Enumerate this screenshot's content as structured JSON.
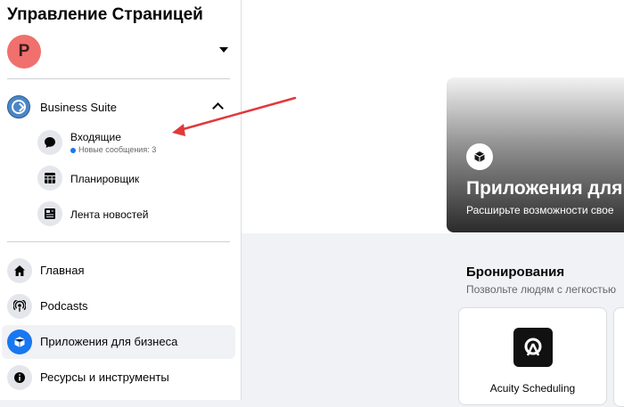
{
  "sidebar": {
    "title": "Управление Страницей",
    "avatar_letter": "P",
    "business_suite": {
      "label": "Business Suite",
      "items": [
        {
          "label": "Входящие",
          "sublabel": "Новые сообщения: 3",
          "icon": "chat-bubble-icon"
        },
        {
          "label": "Планировщик",
          "icon": "calendar-grid-icon"
        },
        {
          "label": "Лента новостей",
          "icon": "news-feed-icon"
        }
      ]
    },
    "nav": [
      {
        "label": "Главная",
        "icon": "home-icon"
      },
      {
        "label": "Podcasts",
        "icon": "podcast-icon"
      },
      {
        "label": "Приложения для бизнеса",
        "icon": "cube-icon",
        "active": true
      },
      {
        "label": "Ресурсы и инструменты",
        "icon": "info-icon"
      }
    ]
  },
  "main": {
    "hero": {
      "title": "Приложения для",
      "subtitle": "Расширьте возможности свое"
    },
    "section": {
      "title": "Бронирования",
      "subtitle": "Позвольте людям с легкостью"
    },
    "cards": [
      {
        "label": "Acuity Scheduling"
      }
    ]
  },
  "colors": {
    "accent": "#1877f2",
    "avatar": "#f0706e",
    "arrow": "#e0393b"
  }
}
